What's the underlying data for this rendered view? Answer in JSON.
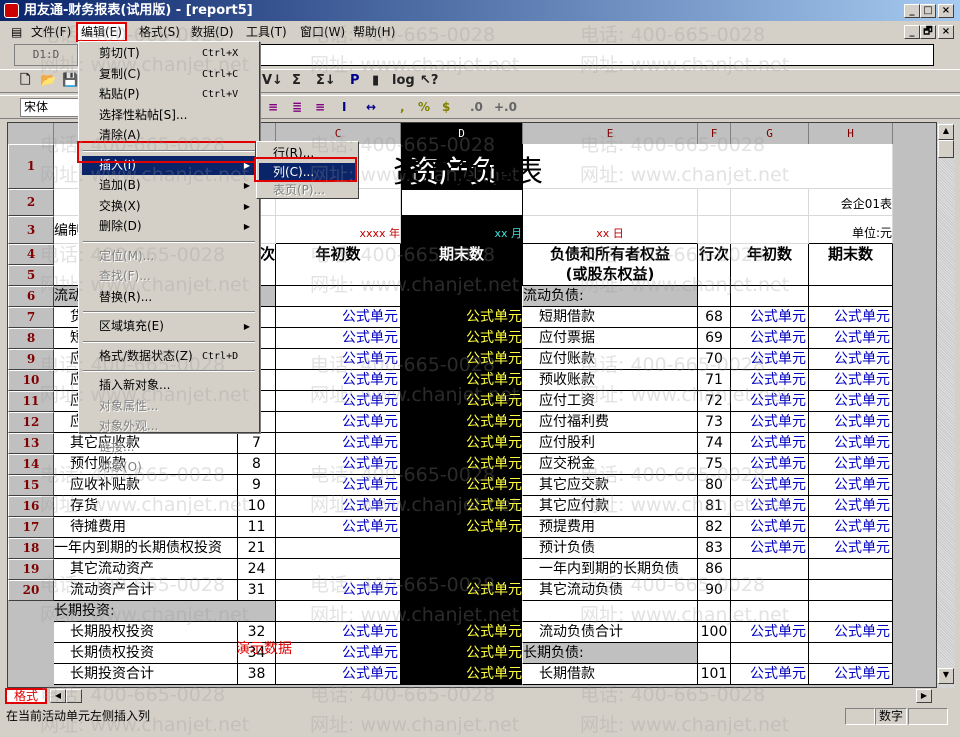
{
  "window": {
    "title": "用友通-财务报表(试用版) - [report5]",
    "min": "_",
    "max": "□",
    "close": "×",
    "restore": "🗗"
  },
  "menubar": [
    "文件(F)",
    "编辑(E)",
    "格式(S)",
    "数据(D)",
    "工具(T)",
    "窗口(W)",
    "帮助(H)"
  ],
  "formula_bar": {
    "cell_ref": "D1:D",
    "value": ""
  },
  "toolbar": {
    "icons": [
      "new-icon",
      "open-icon",
      "save-icon",
      "sort-desc-icon",
      "sum-icon",
      "sum-down-icon",
      "p-icon",
      "brush-icon",
      "log-icon",
      "help-pointer-icon"
    ],
    "glyphs": [
      "🗋",
      "📂",
      "💾",
      "V↓",
      "Σ",
      "Σ↓",
      "P",
      "▮",
      "log",
      "↖?"
    ]
  },
  "format_toolbar": {
    "font": "宋体",
    "glyphs": [
      "≡",
      "≣",
      "≡",
      "I",
      "↔",
      ",",
      "%",
      "$",
      ".0",
      "+.0"
    ]
  },
  "edit_menu": {
    "items": [
      {
        "label": "剪切(T)",
        "shortcut": "Ctrl+X"
      },
      {
        "label": "复制(C)",
        "shortcut": "Ctrl+C"
      },
      {
        "label": "粘贴(P)",
        "shortcut": "Ctrl+V"
      },
      {
        "label": "选择性粘帖[S]..."
      },
      {
        "label": "清除(A)"
      },
      {
        "label": "插入(I)",
        "submenu": true,
        "selected": true
      },
      {
        "label": "追加(B)",
        "submenu": true
      },
      {
        "label": "交换(X)",
        "submenu": true
      },
      {
        "label": "删除(D)",
        "submenu": true
      },
      {
        "label": "定位(M)...",
        "disabled": true
      },
      {
        "label": "查找(F)...",
        "disabled": true
      },
      {
        "label": "替换(R)..."
      },
      {
        "label": "区域填充(E)",
        "submenu": true
      },
      {
        "label": "格式/数据状态(Z)",
        "shortcut": "Ctrl+D"
      },
      {
        "label": "插入新对象..."
      },
      {
        "label": "对象属性...",
        "disabled": true
      },
      {
        "label": "对象外观...",
        "disabled": true
      },
      {
        "label": "链接...",
        "disabled": true
      },
      {
        "label": "对象(O)",
        "disabled": true
      }
    ]
  },
  "insert_submenu": [
    {
      "label": "行(R)..."
    },
    {
      "label": "列(C)...",
      "selected": true
    },
    {
      "label": "表页(P)...",
      "disabled": true
    }
  ],
  "sheet": {
    "columns": [
      "A",
      "B",
      "C",
      "D",
      "E",
      "F",
      "G",
      "H"
    ],
    "title": "资产负债表",
    "form_no": "会企01表",
    "unit": "单位:元",
    "prepared_by": "编制单位:",
    "year": "xxxx 年",
    "month": "xx 月",
    "day": "xx 日",
    "headers": {
      "assets": "资产",
      "row_no": "行次",
      "begin": "年初数",
      "end": "期末数",
      "liab": "负债和所有者权益",
      "liab2": "(或股东权益)",
      "row_no2": "行次",
      "begin2": "年初数",
      "end2": "期末数"
    },
    "formula_text": "公式单元",
    "demo_label": "演示数据",
    "rows": [
      {
        "n": 6,
        "a": "流动资产:",
        "agray": true,
        "e": "流动负债:",
        "egray": true
      },
      {
        "n": 7,
        "a": "货币资金",
        "b": "1",
        "cf": true,
        "e": "短期借款",
        "f": "68",
        "gf": true
      },
      {
        "n": 8,
        "a": "短期投资",
        "b": "2",
        "cf": true,
        "e": "应付票据",
        "f": "69",
        "gf": true
      },
      {
        "n": 9,
        "a": "应收票据",
        "b": "3",
        "cf": true,
        "e": "应付账款",
        "f": "70",
        "gf": true
      },
      {
        "n": 10,
        "a": "应收股利",
        "b": "4",
        "cf": true,
        "e": "预收账款",
        "f": "71",
        "gf": true
      },
      {
        "n": 11,
        "a": "应收利息",
        "b": "5",
        "cf": true,
        "e": "应付工资",
        "f": "72",
        "gf": true
      },
      {
        "n": 12,
        "a": "应收账款",
        "b": "6",
        "cf": true,
        "e": "应付福利费",
        "f": "73",
        "gf": true
      },
      {
        "n": 13,
        "a": "其它应收款",
        "b": "7",
        "cf": true,
        "e": "应付股利",
        "f": "74",
        "gf": true
      },
      {
        "n": 14,
        "a": "预付账款",
        "b": "8",
        "cf": true,
        "e": "应交税金",
        "f": "75",
        "gf": true
      },
      {
        "n": 15,
        "a": "应收补贴款",
        "b": "9",
        "cf": true,
        "e": "其它应交款",
        "f": "80",
        "gf": true
      },
      {
        "n": 16,
        "a": "存货",
        "b": "10",
        "cf": true,
        "e": "其它应付款",
        "f": "81",
        "gf": true
      },
      {
        "n": 17,
        "a": "待摊费用",
        "b": "11",
        "cf": true,
        "e": "预提费用",
        "f": "82",
        "gf": true
      },
      {
        "n": 18,
        "a": "一年内到期的长期债权投资",
        "b": "21",
        "noindent": true,
        "e": "预计负债",
        "f": "83",
        "gf": true
      },
      {
        "n": 19,
        "a": "其它流动资产",
        "b": "24",
        "e": "一年内到期的长期负债",
        "f": "86"
      },
      {
        "n": 20,
        "a": "流动资产合计",
        "b": "31",
        "cf": true,
        "e": "其它流动负债",
        "f": "90"
      },
      {
        "n": 21,
        "a": "长期投资:",
        "agray": true
      },
      {
        "n": 22,
        "a": "长期股权投资",
        "b": "32",
        "cf": true,
        "e": "流动负债合计",
        "f": "100",
        "gf": true
      },
      {
        "n": 23,
        "a": "长期债权投资",
        "b": "34",
        "cf": true,
        "e": "长期负债:",
        "egray": true
      },
      {
        "n": 24,
        "a": "长期投资合计",
        "b": "38",
        "cf": true,
        "e": "长期借款",
        "f": "101",
        "gf": true
      }
    ]
  },
  "sheet_tab": "格式",
  "status": {
    "message": "在当前活动单元左侧插入列",
    "mode": "数字"
  },
  "watermark": {
    "phone": "电话: 400-665-0028",
    "site": "网址: www.chanjet.net"
  },
  "colors": {
    "highlight": "#e00000",
    "selection": "#0a246a",
    "formula": "#0000c0",
    "formula_on_black": "#ffff40"
  }
}
